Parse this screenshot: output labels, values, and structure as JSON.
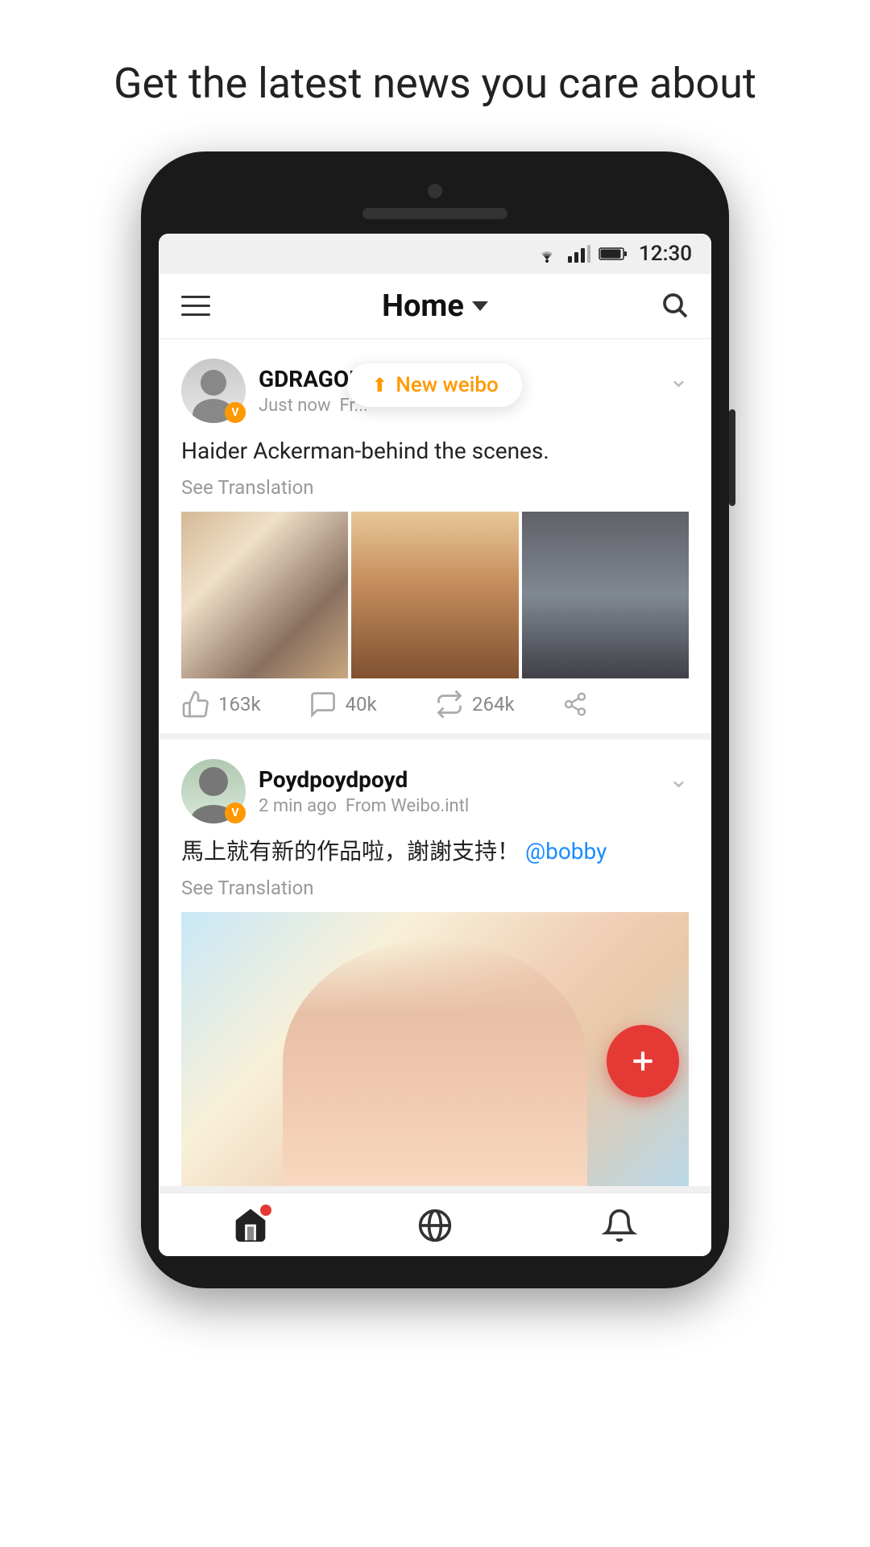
{
  "headline": "Get the latest news you care about",
  "status_bar": {
    "time": "12:30"
  },
  "header": {
    "title": "Home",
    "menu_label": "Menu",
    "search_label": "Search"
  },
  "toast": {
    "text": "New weibo"
  },
  "posts": [
    {
      "id": "post1",
      "username": "GDRAGON",
      "time": "Just now",
      "source": "Fr...",
      "content": "Haider Ackerman-behind the scenes.",
      "see_translation": "See Translation",
      "likes": "163k",
      "comments": "40k",
      "reposts": "264k",
      "image_count": 3
    },
    {
      "id": "post2",
      "username": "Poydpoydpoyd",
      "time": "2 min ago",
      "source": "From Weibo.intl",
      "content": "馬上就有新的作品啦，謝謝支持！",
      "mention": "@bobby",
      "see_translation": "See Translation",
      "image_count": 1
    }
  ],
  "nav": {
    "home_label": "Home",
    "discover_label": "Discover",
    "notification_label": "Notifications"
  },
  "fab": {
    "label": "Compose"
  }
}
